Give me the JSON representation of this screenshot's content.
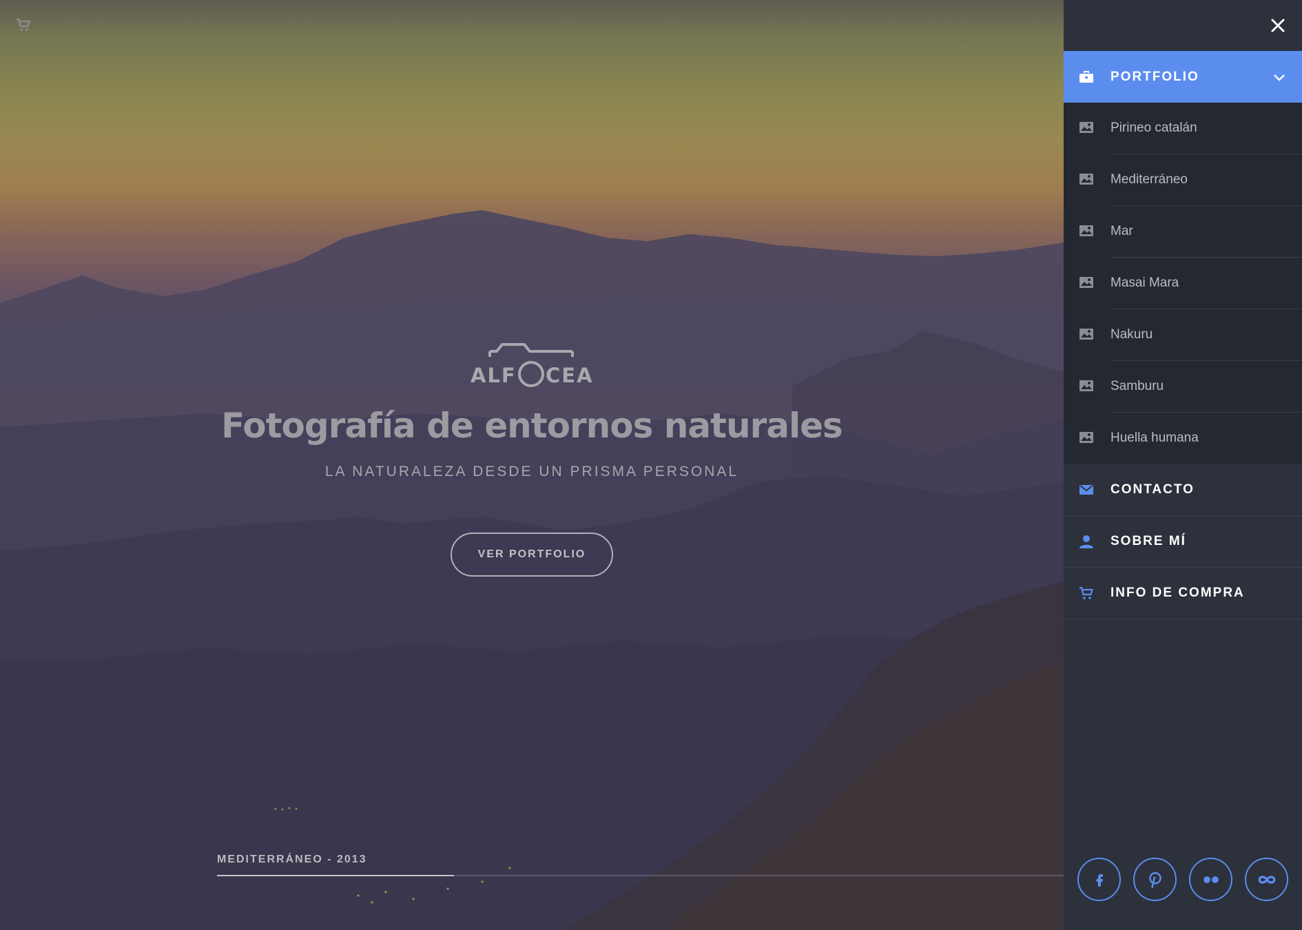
{
  "hero": {
    "cart_icon": "cart-icon",
    "logo_text": "ALFOCEA",
    "title": "Fotografía de entornos naturales",
    "subtitle": "LA NATURALEZA DESDE UN PRISMA PERSONAL",
    "cta_label": "VER PORTFOLIO",
    "caption": "MEDITERRÁNEO - 2013",
    "slide_progress": 0.28
  },
  "sidebar": {
    "close_icon": "close-icon",
    "active_item": {
      "label": "PORTFOLIO",
      "icon": "briefcase-icon"
    },
    "submenu": [
      {
        "label": "Pirineo catalán",
        "icon": "image-icon"
      },
      {
        "label": "Mediterráneo",
        "icon": "image-icon"
      },
      {
        "label": "Mar",
        "icon": "image-icon"
      },
      {
        "label": "Masai Mara",
        "icon": "image-icon"
      },
      {
        "label": "Nakuru",
        "icon": "image-icon"
      },
      {
        "label": "Samburu",
        "icon": "image-icon"
      },
      {
        "label": "Huella humana",
        "icon": "image-icon"
      }
    ],
    "main_items": [
      {
        "label": "CONTACTO",
        "icon": "envelope-icon"
      },
      {
        "label": "SOBRE MÍ",
        "icon": "user-icon"
      },
      {
        "label": "INFO DE COMPRA",
        "icon": "cart-icon"
      }
    ],
    "social": [
      "facebook-icon",
      "pinterest-icon",
      "flickr-icon",
      "infinity-icon"
    ]
  },
  "colors": {
    "accent": "#5b8def",
    "sidebar_bg": "#2d313b",
    "submenu_bg": "#242830"
  }
}
